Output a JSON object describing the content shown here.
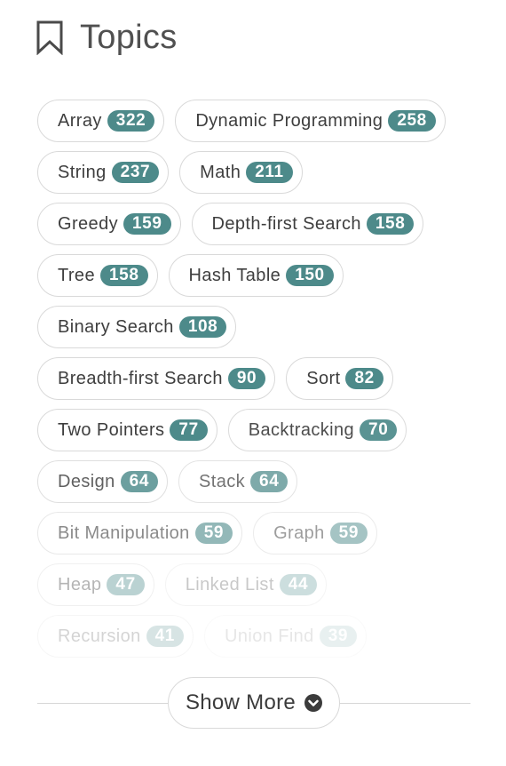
{
  "header": {
    "icon": "bookmark-icon",
    "title": "Topics"
  },
  "accent_color": "#4d8a8a",
  "topic_rows": [
    [
      {
        "name": "Array",
        "count": "322",
        "opacity": 1
      },
      {
        "name": "Dynamic Programming",
        "count": "258",
        "opacity": 1
      }
    ],
    [
      {
        "name": "String",
        "count": "237",
        "opacity": 1
      },
      {
        "name": "Math",
        "count": "211",
        "opacity": 1
      }
    ],
    [
      {
        "name": "Greedy",
        "count": "159",
        "opacity": 1
      },
      {
        "name": "Depth-first Search",
        "count": "158",
        "opacity": 1
      }
    ],
    [
      {
        "name": "Tree",
        "count": "158",
        "opacity": 1
      },
      {
        "name": "Hash Table",
        "count": "150",
        "opacity": 1
      }
    ],
    [
      {
        "name": "Binary Search",
        "count": "108",
        "opacity": 1
      }
    ],
    [
      {
        "name": "Breadth-first Search",
        "count": "90",
        "opacity": 1
      },
      {
        "name": "Sort",
        "count": "82",
        "opacity": 1
      }
    ],
    [
      {
        "name": "Two Pointers",
        "count": "77",
        "opacity": 1
      },
      {
        "name": "Backtracking",
        "count": "70",
        "opacity": 0.92
      }
    ],
    [
      {
        "name": "Design",
        "count": "64",
        "opacity": 0.82
      },
      {
        "name": "Stack",
        "count": "64",
        "opacity": 0.72
      }
    ],
    [
      {
        "name": "Bit Manipulation",
        "count": "59",
        "opacity": 0.6
      },
      {
        "name": "Graph",
        "count": "59",
        "opacity": 0.5
      }
    ],
    [
      {
        "name": "Heap",
        "count": "47",
        "opacity": 0.38
      },
      {
        "name": "Linked List",
        "count": "44",
        "opacity": 0.28
      }
    ],
    [
      {
        "name": "Recursion",
        "count": "41",
        "opacity": 0.22
      },
      {
        "name": "Union Find",
        "count": "39",
        "opacity": 0.12
      }
    ]
  ],
  "show_more": {
    "label": "Show More",
    "icon": "chevron-down-circle-icon"
  }
}
